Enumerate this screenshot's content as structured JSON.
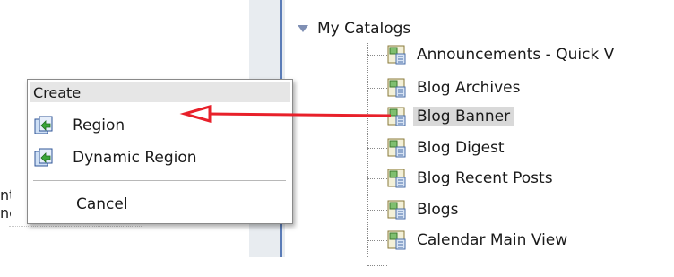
{
  "left_pane": {
    "partial_text_1": "nt",
    "partial_text_2": "ne"
  },
  "catalog": {
    "title": "My Catalogs",
    "items": [
      {
        "label": "Announcements - Quick V"
      },
      {
        "label": "Blog Archives"
      },
      {
        "label": "Blog Banner",
        "selected": true
      },
      {
        "label": "Blog Digest"
      },
      {
        "label": "Blog Recent Posts"
      },
      {
        "label": "Blogs"
      },
      {
        "label": "Calendar Main View"
      }
    ]
  },
  "context_menu": {
    "header": "Create",
    "items": [
      {
        "label": "Region",
        "icon": "region-icon"
      },
      {
        "label": "Dynamic Region",
        "icon": "dynamic-region-icon"
      }
    ],
    "cancel_label": "Cancel"
  },
  "colors": {
    "arrow": "#e8202a",
    "selection": "#d9d9d9",
    "splitter": "#5b7cb7"
  }
}
